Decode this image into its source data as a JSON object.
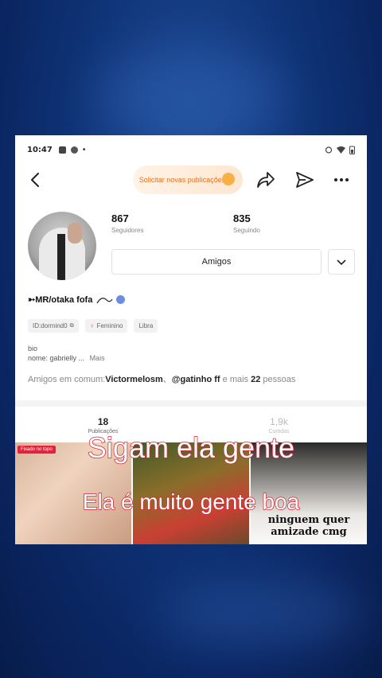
{
  "status_bar": {
    "time": "10:47",
    "dot": "•"
  },
  "top_bar": {
    "request_label": "Solicitar novas publicações"
  },
  "profile": {
    "followers_count": "867",
    "followers_label": "Seguidores",
    "following_count": "835",
    "following_label": "Seguindo",
    "friends_button": "Amigos",
    "name": "➳MR/otaka fofa",
    "tags": [
      "ID:dormind0",
      "Feminino",
      "Libra"
    ],
    "gender_symbol": "♀",
    "bio_line1": "bio",
    "bio_line2": "nome: gabrielly ...",
    "bio_more": "Mais",
    "mutual_prefix": "Amigos em comum:",
    "mutual_user1": "Victormelosm",
    "mutual_sep": "、",
    "mutual_user2": "@gatinho ff",
    "mutual_mid": " e mais ",
    "mutual_count": "22",
    "mutual_suffix": " pessoas"
  },
  "tabs": [
    {
      "num": "18",
      "label": "Publicações"
    },
    {
      "num": "1,9k",
      "label": "Curtidas"
    }
  ],
  "grid": {
    "pinned_label": "Fixado no topo",
    "cell3_text": "ninguem quer amizade cmg"
  },
  "overlay_captions": {
    "line1": "Sigam ela gente",
    "line2": "Ela é muito gente boa"
  },
  "colors": {
    "accent_orange": "#e8701a",
    "pin_red": "#e2233b",
    "caption_stroke": "#d82233",
    "bg_blue": "#0f3376"
  }
}
